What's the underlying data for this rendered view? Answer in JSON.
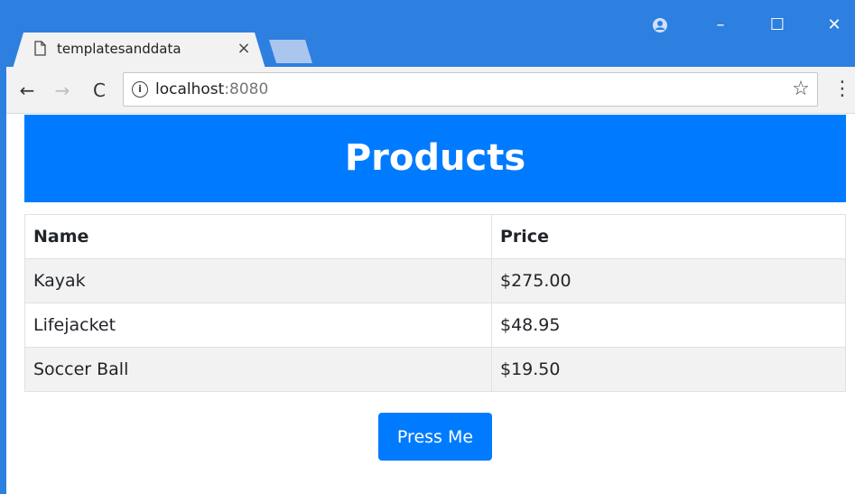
{
  "browser": {
    "tab": {
      "title": "templatesanddata",
      "close_glyph": "×"
    },
    "window_controls": {
      "minimize": "–",
      "maximize": "☐",
      "close": "✕"
    },
    "nav": {
      "back": "←",
      "forward": "→",
      "reload": "C"
    },
    "address": {
      "host": "localhost",
      "port": ":8080",
      "info_glyph": "i"
    },
    "icons": {
      "profile": "account-circle-icon",
      "star": "☆",
      "menu": "⋮"
    },
    "colors": {
      "chrome_blue": "#2d7fe0",
      "toolbar": "#f2f2f2"
    }
  },
  "page": {
    "title": "Products",
    "table": {
      "headers": [
        "Name",
        "Price"
      ],
      "rows": [
        {
          "name": "Kayak",
          "price": "$275.00"
        },
        {
          "name": "Lifejacket",
          "price": "$48.95"
        },
        {
          "name": "Soccer Ball",
          "price": "$19.50"
        }
      ]
    },
    "button": {
      "label": "Press Me"
    },
    "colors": {
      "primary": "#007bff",
      "striped_row": "#f2f2f2"
    }
  }
}
